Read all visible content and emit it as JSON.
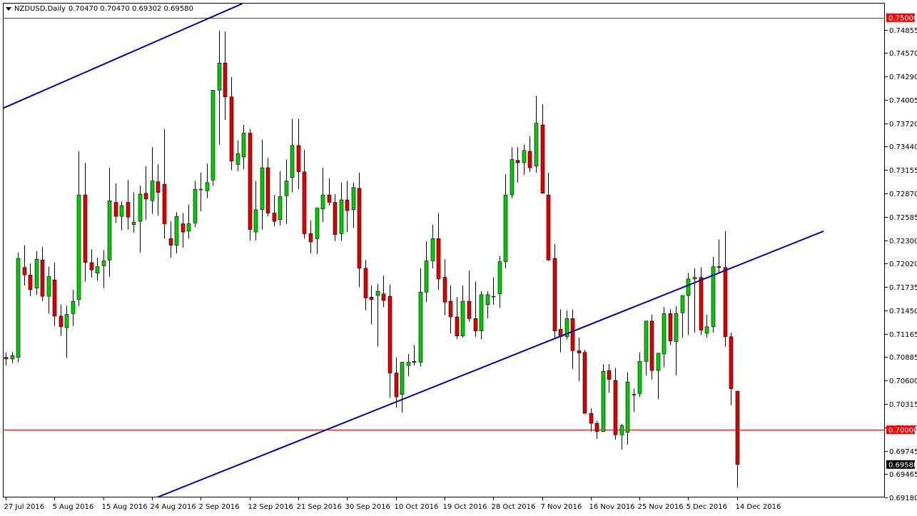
{
  "header": {
    "symbol": "NZDUSD,Daily",
    "ohlc": "0.70470 0.70470 0.69302 0.69580"
  },
  "colors": {
    "up": "#00cc00",
    "down": "#dd0000",
    "wick": "#000000",
    "trendline": "#0000aa",
    "level": "#ff0000",
    "grid": "#000000",
    "current_box": "#000000"
  },
  "chart_data": {
    "type": "candlestick",
    "ylim": [
      0.6918,
      0.7518
    ],
    "y_ticks": [
      "0.74855",
      "0.74570",
      "0.74290",
      "0.74005",
      "0.73720",
      "0.73440",
      "0.73155",
      "0.72870",
      "0.72585",
      "0.72300",
      "0.72020",
      "0.71735",
      "0.71450",
      "0.71165",
      "0.70885",
      "0.70600",
      "0.70315",
      "0.70030",
      "0.69745",
      "0.69465",
      "0.69180"
    ],
    "x_tick_labels": [
      "27 Jul 2016",
      "5 Aug 2016",
      "15 Aug 2016",
      "24 Aug 2016",
      "2 Sep 2016",
      "12 Sep 2016",
      "21 Sep 2016",
      "30 Sep 2016",
      "10 Oct 2016",
      "19 Oct 2016",
      "28 Oct 2016",
      "7 Nov 2016",
      "16 Nov 2016",
      "25 Nov 2016",
      "5 Dec 2016",
      "14 Dec 2016"
    ],
    "x_tick_index": [
      0,
      8,
      16,
      24,
      32,
      40,
      48,
      56,
      64,
      72,
      80,
      88,
      96,
      104,
      112,
      120
    ],
    "horizontal_levels": [
      {
        "value": 0.75,
        "label": "0.75000"
      },
      {
        "value": 0.7,
        "label": "0.70000"
      }
    ],
    "current_price": {
      "value": 0.6958,
      "label": "0.69580"
    },
    "trendlines": [
      {
        "from": [
          -0.8,
          0.7389
        ],
        "to": [
          38.8,
          0.7517
        ]
      },
      {
        "from": [
          24.8,
          0.6918
        ],
        "to": [
          134.2,
          0.7241
        ]
      }
    ],
    "candles": [
      [
        0.7088,
        0.7094,
        0.7078,
        0.7086
      ],
      [
        0.7086,
        0.7094,
        0.7081,
        0.709
      ],
      [
        0.7088,
        0.7215,
        0.7082,
        0.7208
      ],
      [
        0.7197,
        0.7224,
        0.7175,
        0.7188
      ],
      [
        0.7188,
        0.7202,
        0.7162,
        0.717
      ],
      [
        0.7172,
        0.7217,
        0.7164,
        0.7207
      ],
      [
        0.7206,
        0.7222,
        0.7156,
        0.7162
      ],
      [
        0.7162,
        0.7198,
        0.7141,
        0.7186
      ],
      [
        0.7182,
        0.7203,
        0.7126,
        0.7138
      ],
      [
        0.7138,
        0.7152,
        0.7114,
        0.7125
      ],
      [
        0.7124,
        0.7151,
        0.7087,
        0.714
      ],
      [
        0.7141,
        0.717,
        0.7126,
        0.7156
      ],
      [
        0.7158,
        0.7338,
        0.715,
        0.7285
      ],
      [
        0.7285,
        0.7324,
        0.718,
        0.7203
      ],
      [
        0.7203,
        0.7219,
        0.7185,
        0.7194
      ],
      [
        0.719,
        0.7209,
        0.7181,
        0.7198
      ],
      [
        0.7199,
        0.7218,
        0.7172,
        0.7205
      ],
      [
        0.7206,
        0.7318,
        0.7186,
        0.7278
      ],
      [
        0.7276,
        0.7299,
        0.7251,
        0.7259
      ],
      [
        0.7259,
        0.7277,
        0.7242,
        0.7272
      ],
      [
        0.7276,
        0.7303,
        0.7243,
        0.7258
      ],
      [
        0.7249,
        0.7288,
        0.7239,
        0.7252
      ],
      [
        0.7253,
        0.7296,
        0.7215,
        0.7286
      ],
      [
        0.7287,
        0.732,
        0.7255,
        0.728
      ],
      [
        0.7278,
        0.7343,
        0.7262,
        0.7302
      ],
      [
        0.7301,
        0.7322,
        0.726,
        0.7288
      ],
      [
        0.7298,
        0.7365,
        0.7232,
        0.725
      ],
      [
        0.7232,
        0.7253,
        0.7209,
        0.7224
      ],
      [
        0.7224,
        0.7264,
        0.7214,
        0.7259
      ],
      [
        0.725,
        0.7263,
        0.7221,
        0.724
      ],
      [
        0.7241,
        0.7273,
        0.7232,
        0.725
      ],
      [
        0.7251,
        0.7302,
        0.7246,
        0.7292
      ],
      [
        0.7292,
        0.7312,
        0.7265,
        0.7292
      ],
      [
        0.729,
        0.7323,
        0.7281,
        0.73
      ],
      [
        0.7303,
        0.7355,
        0.7296,
        0.7412
      ],
      [
        0.7412,
        0.7484,
        0.7346,
        0.7445
      ],
      [
        0.7445,
        0.7483,
        0.7376,
        0.7404
      ],
      [
        0.7404,
        0.7428,
        0.7315,
        0.7326
      ],
      [
        0.7322,
        0.7351,
        0.7314,
        0.7335
      ],
      [
        0.7331,
        0.737,
        0.7316,
        0.736
      ],
      [
        0.736,
        0.7365,
        0.723,
        0.7243
      ],
      [
        0.724,
        0.7302,
        0.723,
        0.7267
      ],
      [
        0.7267,
        0.7352,
        0.7243,
        0.7318
      ],
      [
        0.7318,
        0.733,
        0.7259,
        0.7263
      ],
      [
        0.7263,
        0.7285,
        0.7247,
        0.7253
      ],
      [
        0.7255,
        0.7314,
        0.7248,
        0.7283
      ],
      [
        0.7284,
        0.7328,
        0.725,
        0.7302
      ],
      [
        0.7306,
        0.7377,
        0.7288,
        0.7345
      ],
      [
        0.7345,
        0.7377,
        0.7292,
        0.7313
      ],
      [
        0.7313,
        0.734,
        0.7232,
        0.7238
      ],
      [
        0.7238,
        0.7254,
        0.7214,
        0.7228
      ],
      [
        0.7232,
        0.7261,
        0.7213,
        0.7269
      ],
      [
        0.7268,
        0.7318,
        0.7252,
        0.7285
      ],
      [
        0.7285,
        0.7305,
        0.7272,
        0.7276
      ],
      [
        0.7276,
        0.7286,
        0.7229,
        0.7237
      ],
      [
        0.7238,
        0.73,
        0.7229,
        0.7279
      ],
      [
        0.7279,
        0.7302,
        0.724,
        0.7266
      ],
      [
        0.7267,
        0.73,
        0.7245,
        0.7294
      ],
      [
        0.7293,
        0.7312,
        0.7173,
        0.7196
      ],
      [
        0.7196,
        0.7206,
        0.7145,
        0.716
      ],
      [
        0.7161,
        0.7175,
        0.7128,
        0.7158
      ],
      [
        0.7163,
        0.7177,
        0.7101,
        0.7168
      ],
      [
        0.7165,
        0.7187,
        0.7149,
        0.7157
      ],
      [
        0.7162,
        0.7176,
        0.7039,
        0.7069
      ],
      [
        0.7069,
        0.7088,
        0.7027,
        0.704
      ],
      [
        0.7043,
        0.7081,
        0.7021,
        0.7082
      ],
      [
        0.7078,
        0.7092,
        0.7065,
        0.7082
      ],
      [
        0.7083,
        0.7103,
        0.7078,
        0.7082
      ],
      [
        0.7082,
        0.7196,
        0.7077,
        0.7167
      ],
      [
        0.7167,
        0.7229,
        0.7155,
        0.7205
      ],
      [
        0.7205,
        0.7249,
        0.7196,
        0.7232
      ],
      [
        0.7232,
        0.7263,
        0.717,
        0.7183
      ],
      [
        0.7185,
        0.7207,
        0.7139,
        0.7155
      ],
      [
        0.7156,
        0.7175,
        0.7117,
        0.7137
      ],
      [
        0.7137,
        0.7161,
        0.711,
        0.7114
      ],
      [
        0.7114,
        0.7175,
        0.7112,
        0.7156
      ],
      [
        0.7156,
        0.7193,
        0.7131,
        0.7135
      ],
      [
        0.7135,
        0.718,
        0.7113,
        0.712
      ],
      [
        0.712,
        0.7168,
        0.711,
        0.7164
      ],
      [
        0.7152,
        0.7168,
        0.7135,
        0.7164
      ],
      [
        0.7162,
        0.7185,
        0.7152,
        0.7162
      ],
      [
        0.7165,
        0.7211,
        0.7148,
        0.7204
      ],
      [
        0.7204,
        0.731,
        0.7196,
        0.7285
      ],
      [
        0.7285,
        0.7343,
        0.7281,
        0.7328
      ],
      [
        0.7327,
        0.7343,
        0.73,
        0.7324
      ],
      [
        0.7324,
        0.7346,
        0.7309,
        0.7339
      ],
      [
        0.7338,
        0.7356,
        0.7313,
        0.7318
      ],
      [
        0.732,
        0.7405,
        0.7312,
        0.7372
      ],
      [
        0.737,
        0.7395,
        0.7288,
        0.7287
      ],
      [
        0.7285,
        0.7312,
        0.7205,
        0.7206
      ],
      [
        0.7208,
        0.7225,
        0.7112,
        0.712
      ],
      [
        0.7122,
        0.7146,
        0.7094,
        0.7113
      ],
      [
        0.7113,
        0.7145,
        0.711,
        0.7135
      ],
      [
        0.7135,
        0.7146,
        0.7074,
        0.7096
      ],
      [
        0.7096,
        0.7112,
        0.7059,
        0.7093
      ],
      [
        0.7094,
        0.7097,
        0.7022,
        0.702
      ],
      [
        0.702,
        0.7026,
        0.6998,
        0.7008
      ],
      [
        0.7008,
        0.7011,
        0.6989,
        0.6998
      ],
      [
        0.6998,
        0.7079,
        0.6999,
        0.7071
      ],
      [
        0.7072,
        0.708,
        0.7045,
        0.7061
      ],
      [
        0.706,
        0.7075,
        0.6988,
        0.6994
      ],
      [
        0.6994,
        0.7007,
        0.6976,
        0.7005
      ],
      [
        0.6997,
        0.707,
        0.6982,
        0.7058
      ],
      [
        0.7043,
        0.705,
        0.7022,
        0.7043
      ],
      [
        0.7044,
        0.7094,
        0.704,
        0.7083
      ],
      [
        0.7083,
        0.7131,
        0.7066,
        0.7132
      ],
      [
        0.7132,
        0.714,
        0.7061,
        0.7072
      ],
      [
        0.7072,
        0.7086,
        0.7037,
        0.7093
      ],
      [
        0.7092,
        0.7149,
        0.7076,
        0.7141
      ],
      [
        0.7141,
        0.7146,
        0.7103,
        0.7108
      ],
      [
        0.7107,
        0.715,
        0.7066,
        0.7141
      ],
      [
        0.7142,
        0.7162,
        0.7112,
        0.7163
      ],
      [
        0.7163,
        0.719,
        0.7115,
        0.7183
      ],
      [
        0.7183,
        0.7196,
        0.7118,
        0.7185
      ],
      [
        0.7185,
        0.7197,
        0.7115,
        0.7121
      ],
      [
        0.7117,
        0.714,
        0.7112,
        0.7125
      ],
      [
        0.7125,
        0.721,
        0.7118,
        0.7198
      ],
      [
        0.7198,
        0.7231,
        0.719,
        0.7197
      ],
      [
        0.7197,
        0.7241,
        0.7101,
        0.7113
      ],
      [
        0.7113,
        0.7118,
        0.703,
        0.705
      ],
      [
        0.7047,
        0.7047,
        0.693,
        0.6958
      ]
    ]
  }
}
